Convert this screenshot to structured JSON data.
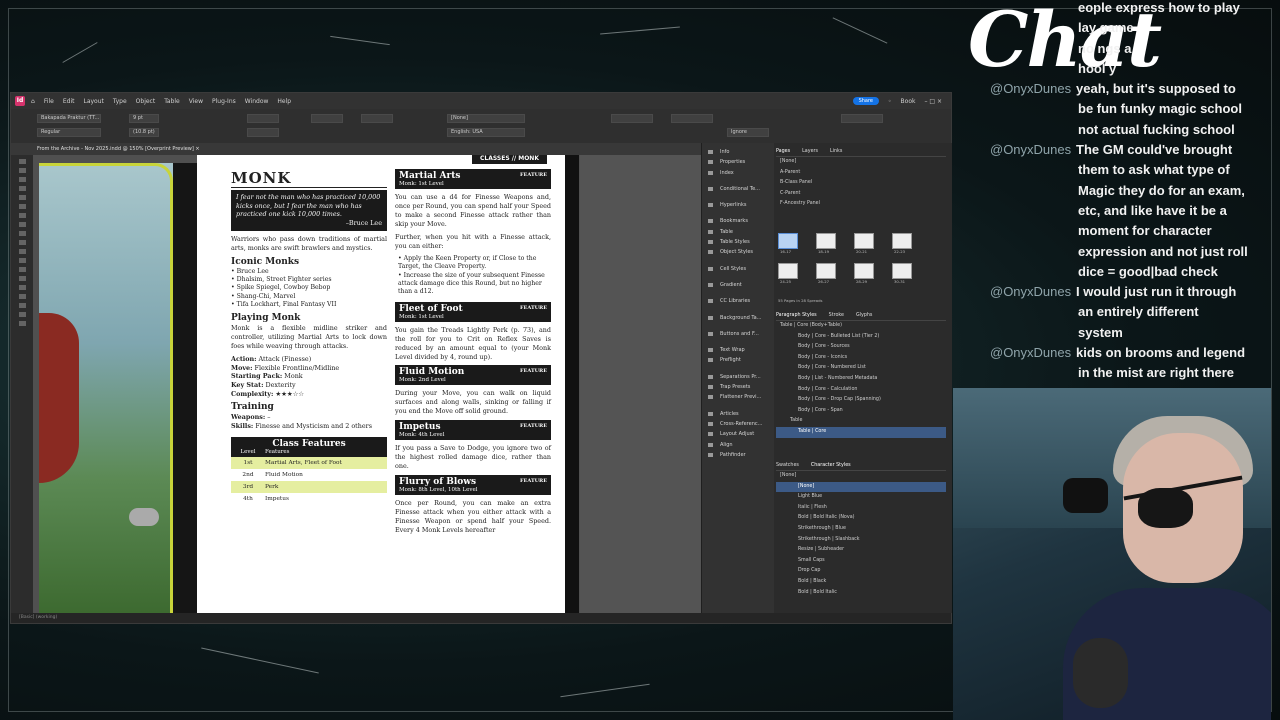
{
  "app": {
    "logo": "Id",
    "menu": [
      "File",
      "Edit",
      "Layout",
      "Type",
      "Object",
      "Table",
      "View",
      "Plug-Ins",
      "Window",
      "Help"
    ],
    "share": "Share",
    "workspace": "Book",
    "font_family": "Bakapada Praktur (TT...",
    "font_style": "Regular",
    "font_size": "9 pt",
    "leading": "(10.8 pt)",
    "paragraph_style": "[None]",
    "language": "English: USA",
    "ignore": "Ignore",
    "doc_tab": "From the Archive - Nov 2025.indd @ 150% [Overprint Preview]",
    "status": "[Basic] (working)"
  },
  "page": {
    "running_head": "CLASSES // MONK",
    "title": "MONK",
    "quote": "I fear not the man who has practiced 10,000 kicks once, but I fear the man who has practiced one kick 10,000 times.",
    "quote_attr": "–Bruce Lee",
    "intro": "Warriors who pass down traditions of martial arts, monks are swift brawlers and mystics.",
    "iconic_heading": "Iconic Monks",
    "iconic": [
      "Bruce Lee",
      "Dhalsim, Street Fighter series",
      "Spike Spiegel, Cowboy Bebop",
      "Shang-Chi, Marvel",
      "Tifa Lockhart, Final Fantasy VII"
    ],
    "playing_heading": "Playing Monk",
    "playing": "Monk is a flexible midline striker and controller, utilizing Martial Arts to lock down foes while weaving through attacks.",
    "stats": [
      {
        "k": "Action:",
        "v": "Attack (Finesse)"
      },
      {
        "k": "Move:",
        "v": "Flexible Frontline/Midline"
      },
      {
        "k": "Starting Pack:",
        "v": "Monk"
      },
      {
        "k": "Key Stat:",
        "v": "Dexterity"
      },
      {
        "k": "Complexity:",
        "v": "★★★☆☆"
      }
    ],
    "training_heading": "Training",
    "training": [
      {
        "k": "Weapons:",
        "v": "–"
      },
      {
        "k": "Skills:",
        "v": "Finesse and Mysticism and 2 others"
      }
    ],
    "class_features": {
      "title": "Class Features",
      "col_level": "Level",
      "col_features": "Features",
      "rows": [
        {
          "level": "1st",
          "features": "Martial Arts, Fleet of Foot"
        },
        {
          "level": "2nd",
          "features": "Fluid Motion"
        },
        {
          "level": "3rd",
          "features": "Perk"
        },
        {
          "level": "4th",
          "features": "Impetus"
        }
      ]
    },
    "features": [
      {
        "name": "Martial Arts",
        "tag": "FEATURE",
        "level": "Monk: 1st Level",
        "text": "You can use a d4 for Finesse Weapons and, once per Round, you can spend half your Speed to make a second Finesse attack rather than skip your Move.",
        "text2": "Further, when you hit with a Finesse attack, you can either:",
        "bullets": [
          "Apply the Keen Property or, if Close to the Target, the Cleave Property.",
          "Increase the size of your subsequent Finesse attack damage dice this Round, but no higher than a d12."
        ]
      },
      {
        "name": "Fleet of Foot",
        "tag": "FEATURE",
        "level": "Monk: 1st Level",
        "text": "You gain the Treads Lightly Perk (p. 73), and the roll for you to Crit on Reflex Saves is reduced by an amount equal to (your Monk Level divided by 4, round up)."
      },
      {
        "name": "Fluid Motion",
        "tag": "FEATURE",
        "level": "Monk: 2nd Level",
        "text": "During your Move, you can walk on liquid surfaces and along walls, sinking or falling if you end the Move off solid ground."
      },
      {
        "name": "Impetus",
        "tag": "FEATURE",
        "level": "Monk: 4th Level",
        "text": "If you pass a Save to Dodge, you ignore two of the highest rolled damage dice, rather than one."
      },
      {
        "name": "Flurry of Blows",
        "tag": "FEATURE",
        "level": "Monk: 8th Level, 10th Level",
        "text": "Once per Round, you can make an extra Finesse attack when you either attack with a Finesse Weapon or spend half your Speed. Every 4 Monk Levels hereafter"
      }
    ]
  },
  "panels": {
    "list": [
      "Info",
      "Properties",
      "Index",
      "",
      "Conditional Te...",
      "",
      "Hyperlinks",
      "",
      "Bookmarks",
      "Table",
      "Table Styles",
      "Object Styles",
      "",
      "Cell Styles",
      "",
      "Gradient",
      "",
      "CC Libraries",
      "",
      "Background Ta...",
      "",
      "Buttons and F...",
      "",
      "Text Wrap",
      "Preflight",
      "",
      "Separations Pr...",
      "Trap Presets",
      "Flattener Previ...",
      "",
      "Articles",
      "Cross-Referenc...",
      "Layout Adjust",
      "Align",
      "Pathfinder"
    ],
    "pages_tabs": [
      "Pages",
      "Layers",
      "Links"
    ],
    "masters": [
      "[None]",
      "A-Parent",
      "B-Class Panel",
      "C-Parent",
      "F-Ancestry Panel"
    ],
    "thumb_labels": [
      "16-17",
      "18-19",
      "20-21",
      "22-23",
      "24-25",
      "26-27",
      "28-29",
      "30-31"
    ],
    "pages_summary": "55 Pages in 28 Spreads",
    "para_tabs": [
      "Paragraph Styles",
      "Stroke",
      "Glyphs"
    ],
    "para_current": "Table | Core (Body+Table)",
    "para_styles": [
      "Body | Core - Bulleted List (Tier 2)",
      "Body | Core - Sources",
      "Body | Core - Iconics",
      "Body | Core - Numbered List",
      "Body | List - Numbered Metadata",
      "Body | Core - Calculation",
      "Body | Core - Drop Cap (Spanning)",
      "Body | Core - Span",
      "Table",
      "Table | Core"
    ],
    "char_tabs": [
      "Swatches",
      "Character Styles"
    ],
    "char_current": "[None]",
    "char_styles": [
      "[None]",
      "Light Blue",
      "Italic | Flesh",
      "Bold | Bold Italic (Nova)",
      "Strikethrough | Blue",
      "Strikethrough | Slashback",
      "Resize | Subheader",
      "Small Caps",
      "Drop Cap",
      "Bold | Black",
      "Bold | Bold Italic"
    ]
  },
  "chat": {
    "title": "Chat",
    "messages": [
      {
        "user": "",
        "lines": [
          "eople express how to play"
        ]
      },
      {
        "user": "",
        "lines": [
          "lay game"
        ]
      },
      {
        "user": "",
        "lines": [
          "no   ngs a"
        ]
      },
      {
        "user": "",
        "lines": [
          "hool   y"
        ]
      },
      {
        "user": "@OnyxDunes",
        "lines": [
          "yeah, but it's supposed to",
          "be fun funky magic school",
          "not actual fucking school"
        ]
      },
      {
        "user": "@OnyxDunes",
        "lines": [
          "The GM could've brought",
          "them to ask what type of",
          "Magic they do for an exam,",
          "etc, and like have it be a",
          "moment for character",
          "expression and not just roll",
          "dice = good|bad check"
        ]
      },
      {
        "user": "@OnyxDunes",
        "lines": [
          "I would just run it through",
          "an entirely different",
          "system"
        ]
      },
      {
        "user": "@OnyxDunes",
        "lines": [
          "kids on brooms and legend",
          "in the mist are right there"
        ]
      }
    ]
  }
}
